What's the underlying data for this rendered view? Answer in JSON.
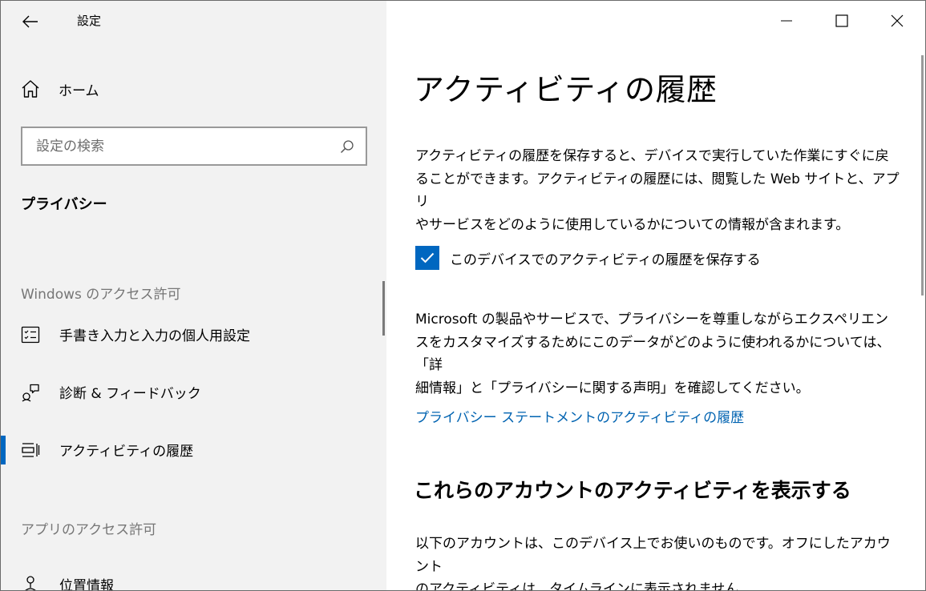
{
  "app": {
    "title": "設定"
  },
  "sidebar": {
    "home_label": "ホーム",
    "search_placeholder": "設定の検索",
    "section_title": "プライバシー",
    "groups": [
      {
        "header": "Windows のアクセス許可"
      },
      {
        "header": "アプリのアクセス許可"
      }
    ],
    "items": [
      {
        "label": "手書き入力と入力の個人用設定",
        "icon": "handwriting-icon"
      },
      {
        "label": "診断 & フィードバック",
        "icon": "feedback-icon"
      },
      {
        "label": "アクティビティの履歴",
        "icon": "activity-history-icon",
        "selected": true
      },
      {
        "label": "位置情報",
        "icon": "location-icon"
      }
    ]
  },
  "window_controls": [
    "minimize",
    "maximize",
    "close"
  ],
  "main": {
    "title": "アクティビティの履歴",
    "intro_lines": [
      "アクティビティの履歴を保存すると、デバイスで実行していた作業にすぐに戻",
      "ることができます。アクティビティの履歴には、閲覧した Web サイトと、アプリ",
      "やサービスをどのように使用しているかについての情報が含まれます。"
    ],
    "checkbox": {
      "label": "このデバイスでのアクティビティの履歴を保存する",
      "checked": true
    },
    "privacy_lines": [
      "Microsoft の製品やサービスで、プライバシーを尊重しながらエクスペリエン",
      "スをカスタマイズするためにこのデータがどのように使われるかについては、「詳",
      "細情報」と「プライバシーに関する声明」を確認してください。"
    ],
    "link": "プライバシー ステートメントのアクティビティの履歴",
    "accounts_heading": "これらのアカウントのアクティビティを表示する",
    "accounts_lines": [
      "以下のアカウントは、このデバイス上でお使いのものです。オフにしたアカウント",
      "のアクティビティは、タイムラインに表示されません。"
    ]
  },
  "colors": {
    "accent": "#0067c0",
    "link": "#0063b1",
    "sidebar_bg": "#f2f2f2"
  }
}
